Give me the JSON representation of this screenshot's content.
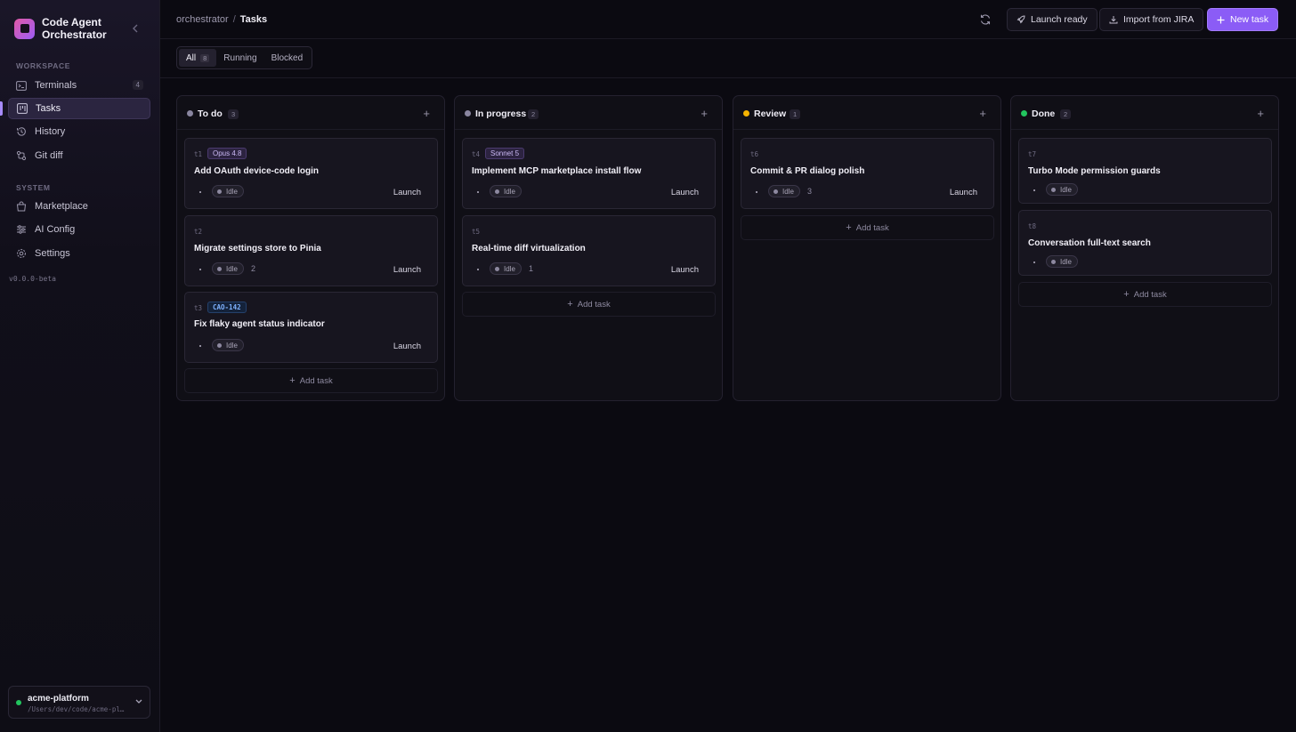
{
  "app": {
    "title": "Code Agent Orchestrator",
    "version": "v0.0.0-beta"
  },
  "sidebar": {
    "workspace_label": "WORKSPACE",
    "system_label": "SYSTEM",
    "workspace_items": [
      {
        "label": "Terminals",
        "icon": "terminal-icon",
        "count": "4"
      },
      {
        "label": "Tasks",
        "icon": "kanban-icon",
        "active": true
      },
      {
        "label": "History",
        "icon": "history-icon"
      },
      {
        "label": "Git diff",
        "icon": "git-diff-icon"
      }
    ],
    "system_items": [
      {
        "label": "Marketplace",
        "icon": "shopping-bag-icon"
      },
      {
        "label": "AI Config",
        "icon": "sliders-icon"
      },
      {
        "label": "Settings",
        "icon": "gear-icon"
      }
    ],
    "project": {
      "name": "acme-platform",
      "path": "/Users/dev/code/acme-pl…",
      "status_color": "#22c55e"
    }
  },
  "header": {
    "breadcrumb_root": "orchestrator",
    "breadcrumb_sep": "/",
    "breadcrumb_current": "Tasks",
    "launch_ready_label": "Launch ready",
    "import_label": "Import from JIRA",
    "new_task_label": "New task",
    "accent_color": "#8b5cf6"
  },
  "filters": [
    {
      "label": "All",
      "count": "8",
      "active": true
    },
    {
      "label": "Running"
    },
    {
      "label": "Blocked"
    }
  ],
  "columns": [
    {
      "title": "To do",
      "count": "3",
      "dot_color": "#8a86a0",
      "cards": [
        {
          "id": "t1",
          "tag": "Opus 4.8",
          "tag_type": "model",
          "title": "Add OAuth device-code login",
          "status": "Idle",
          "num": "",
          "launch": "Launch"
        },
        {
          "id": "t2",
          "tag": "",
          "title": "Migrate settings store to Pinia",
          "status": "Idle",
          "num": "2",
          "launch": "Launch"
        },
        {
          "id": "t3",
          "tag": "CAO-142",
          "tag_type": "jira",
          "title": "Fix flaky agent status indicator",
          "status": "Idle",
          "num": "",
          "launch": "Launch"
        }
      ],
      "add_label": "Add task"
    },
    {
      "title": "In progress",
      "count": "2",
      "dot_color": "#8a86a0",
      "cards": [
        {
          "id": "t4",
          "tag": "Sonnet 5",
          "tag_type": "model",
          "title": "Implement MCP marketplace install flow",
          "status": "Idle",
          "num": "",
          "launch": "Launch"
        },
        {
          "id": "t5",
          "tag": "",
          "title": "Real-time diff virtualization",
          "status": "Idle",
          "num": "1",
          "launch": "Launch"
        }
      ],
      "add_label": "Add task"
    },
    {
      "title": "Review",
      "count": "1",
      "dot_color": "#f5b301",
      "cards": [
        {
          "id": "t6",
          "tag": "",
          "title": "Commit & PR dialog polish",
          "status": "Idle",
          "num": "3",
          "launch": "Launch"
        }
      ],
      "add_label": "Add task"
    },
    {
      "title": "Done",
      "count": "2",
      "dot_color": "#22c55e",
      "cards": [
        {
          "id": "t7",
          "tag": "",
          "title": "Turbo Mode permission guards",
          "status": "Idle",
          "num": "",
          "launch": ""
        },
        {
          "id": "t8",
          "tag": "",
          "title": "Conversation full-text search",
          "status": "Idle",
          "num": "",
          "launch": ""
        }
      ],
      "add_label": "Add task"
    }
  ]
}
